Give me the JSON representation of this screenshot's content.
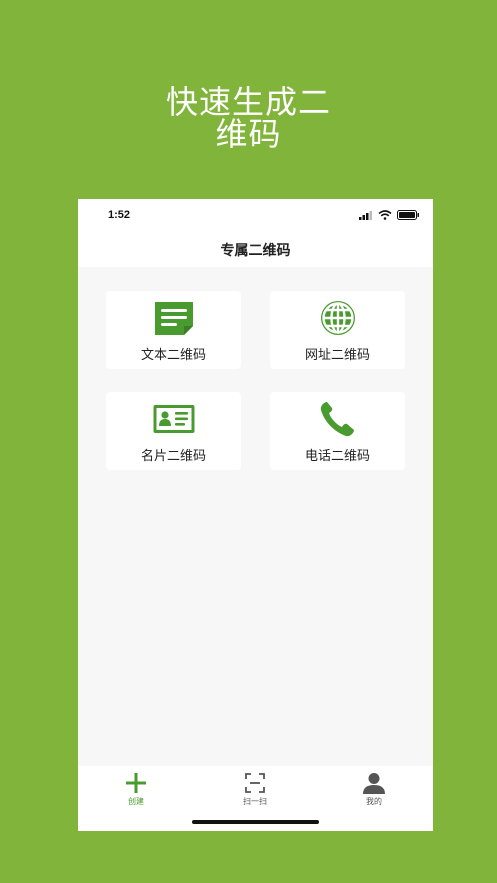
{
  "promo": {
    "line1": "快速生成二",
    "line2": "维码"
  },
  "status_bar": {
    "time": "1:52"
  },
  "header": {
    "title": "专属二维码"
  },
  "cards": [
    {
      "label": "文本二维码",
      "icon": "text-document-icon"
    },
    {
      "label": "网址二维码",
      "icon": "globe-icon"
    },
    {
      "label": "名片二维码",
      "icon": "business-card-icon"
    },
    {
      "label": "电话二维码",
      "icon": "phone-icon"
    }
  ],
  "tabs": [
    {
      "label": "创建",
      "icon": "plus-icon",
      "active": true
    },
    {
      "label": "扫一扫",
      "icon": "scan-icon",
      "active": false
    },
    {
      "label": "我的",
      "icon": "person-icon",
      "active": false
    }
  ],
  "colors": {
    "background": "#80b43a",
    "accent": "#4a9b2f",
    "tab_inactive": "#555555"
  }
}
